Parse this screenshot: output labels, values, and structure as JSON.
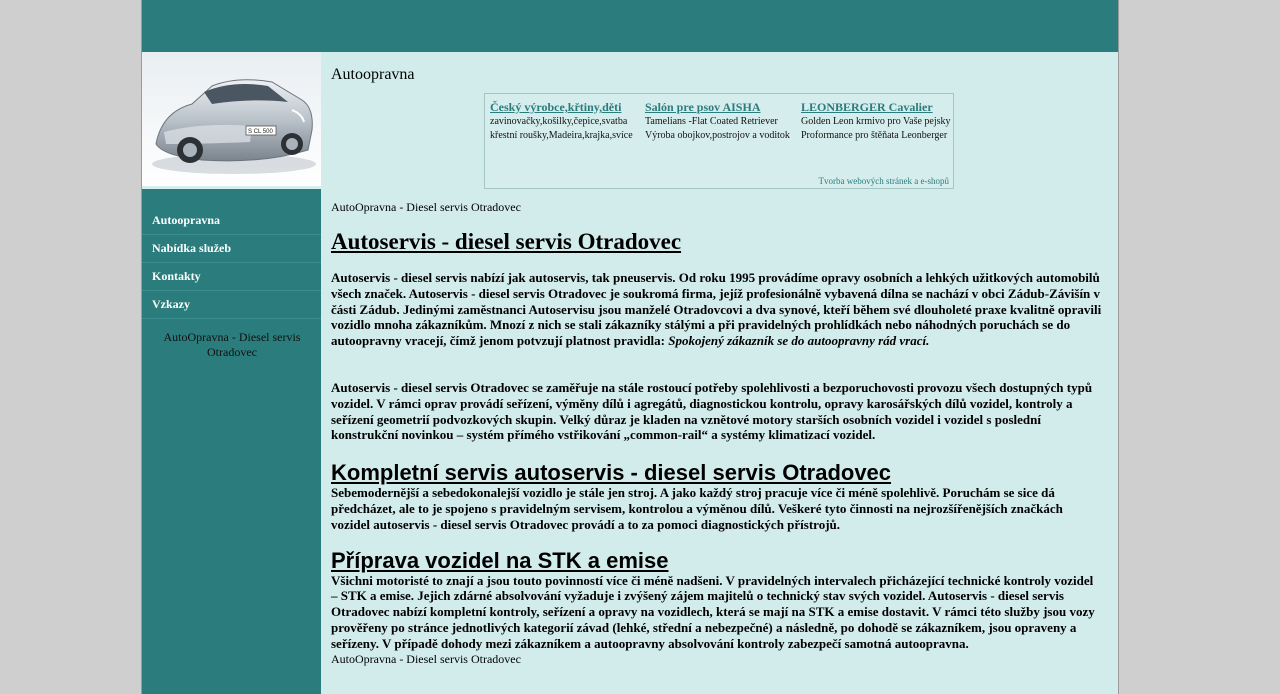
{
  "site_title": "Autoopravna",
  "nav": [
    {
      "label": "Autoopravna"
    },
    {
      "label": "Nabídka služeb"
    },
    {
      "label": "Kontakty"
    },
    {
      "label": "Vzkazy"
    }
  ],
  "sidebar_text": "AutoOpravna - Diesel servis Otradovec",
  "ads": [
    {
      "title": "Český výrobce,křtiny,děti",
      "text": "zavinovačky,košilky,čepice,svatba křestní roušky,Madeira,krajka,svíce"
    },
    {
      "title": "Salón pre psov AISHA",
      "text": "Tamelians -Flat Coated Retriever Výroba obojkov,postrojov a voditok"
    },
    {
      "title": "LEONBERGER Cavalier",
      "text": "Golden Leon krmivo pro Vaše pejsky Proformance pro štěňata Leonberger"
    }
  ],
  "ad_footer": "Tvorba webových stránek a e-shopů",
  "breadcrumb": "AutoOpravna - Diesel servis Otradovec",
  "heading": "Autoservis - diesel servis Otradovec",
  "para1": "Autoservis - diesel servis nabízí jak autoservis, tak pneuservis. Od roku 1995 provádíme opravy osobních a lehkých užitkových automobilů všech značek. Autoservis - diesel servis Otradovec je soukromá firma, jejíž profesionálně vybavená dílna se nachází v obci Zádub-Závišín v části Zádub. Jedinými zaměstnanci Autoservisu jsou manželé Otradovcovi a dva synové, kteří během své dlouholeté praxe kvalitně opravili vozidlo mnoha zákazníkům. Mnozí z nich se stali zákazníky stálými a při pravidelných prohlídkách nebo náhodných poruchách se do autoopravny vracejí, čímž jenom potvzují platnost pravidla: ",
  "para1_quote": "Spokojený zákazník se do autoopravny rád vrací.",
  "para2": "Autoservis - diesel servis Otradovec se zaměřuje na stále rostoucí potřeby spolehlivosti a bezporuchovosti provozu všech dostupných typů vozidel. V rámci oprav provádí seřízení, výměny dílů i agregátů, diagnostickou kontrolu, opravy karosářských dílů vozidel, kontroly a seřízení geometrií podvozkových skupin. Velký důraz je kladen na vznětové motory starších osobních vozidel i vozidel s poslední konstrukční novinkou – systém přímého vstřikování „common-rail“ a systémy klimatizací vozidel.",
  "section1_title": "Kompletní servis autoservis - diesel servis Otradovec",
  "section1_text": "Sebemodernější a sebedokonalejší vozidlo je stále jen stroj. A jako každý stroj pracuje více či méně spolehlivě. Poruchám se sice dá předcházet, ale to je spojeno s pravidelným servisem, kontrolou a výměnou dílů. Veškeré tyto činnosti na nejrozšířenějších značkách vozidel autoservis - diesel servis Otradovec provádí a to za pomoci diagnostických přístrojů.",
  "section2_title": "Příprava vozidel na STK a emise",
  "section2_text": "Všichni motoristé to znají a jsou touto povinností více či méně nadšeni. V pravidelných intervalech přicházející technické kontroly vozidel – STK a emise. Jejich zdárné absolvování vyžaduje i zvýšený zájem majitelů o technický stav svých vozidel. Autoservis - diesel servis Otradovec nabízí kompletní kontroly, seřízení a opravy na vozidlech, která se mají na STK a emise dostavit. V rámci této služby jsou vozy prověřeny po stránce jednotlivých kategorií závad (lehké, střední a nebezpečné) a následně, po dohodě se zákazníkem, jsou opraveny a seřízeny. V případě dohody mezi zákazníkem a autoopravny absolvování kontroly zabezpečí samotná autoopravna.",
  "footer_crumb": "AutoOpravna - Diesel servis Otradovec",
  "colors": {
    "teal": "#2b7c7c",
    "content_bg": "#d2ecec",
    "page_bg": "#cfcfcf"
  }
}
